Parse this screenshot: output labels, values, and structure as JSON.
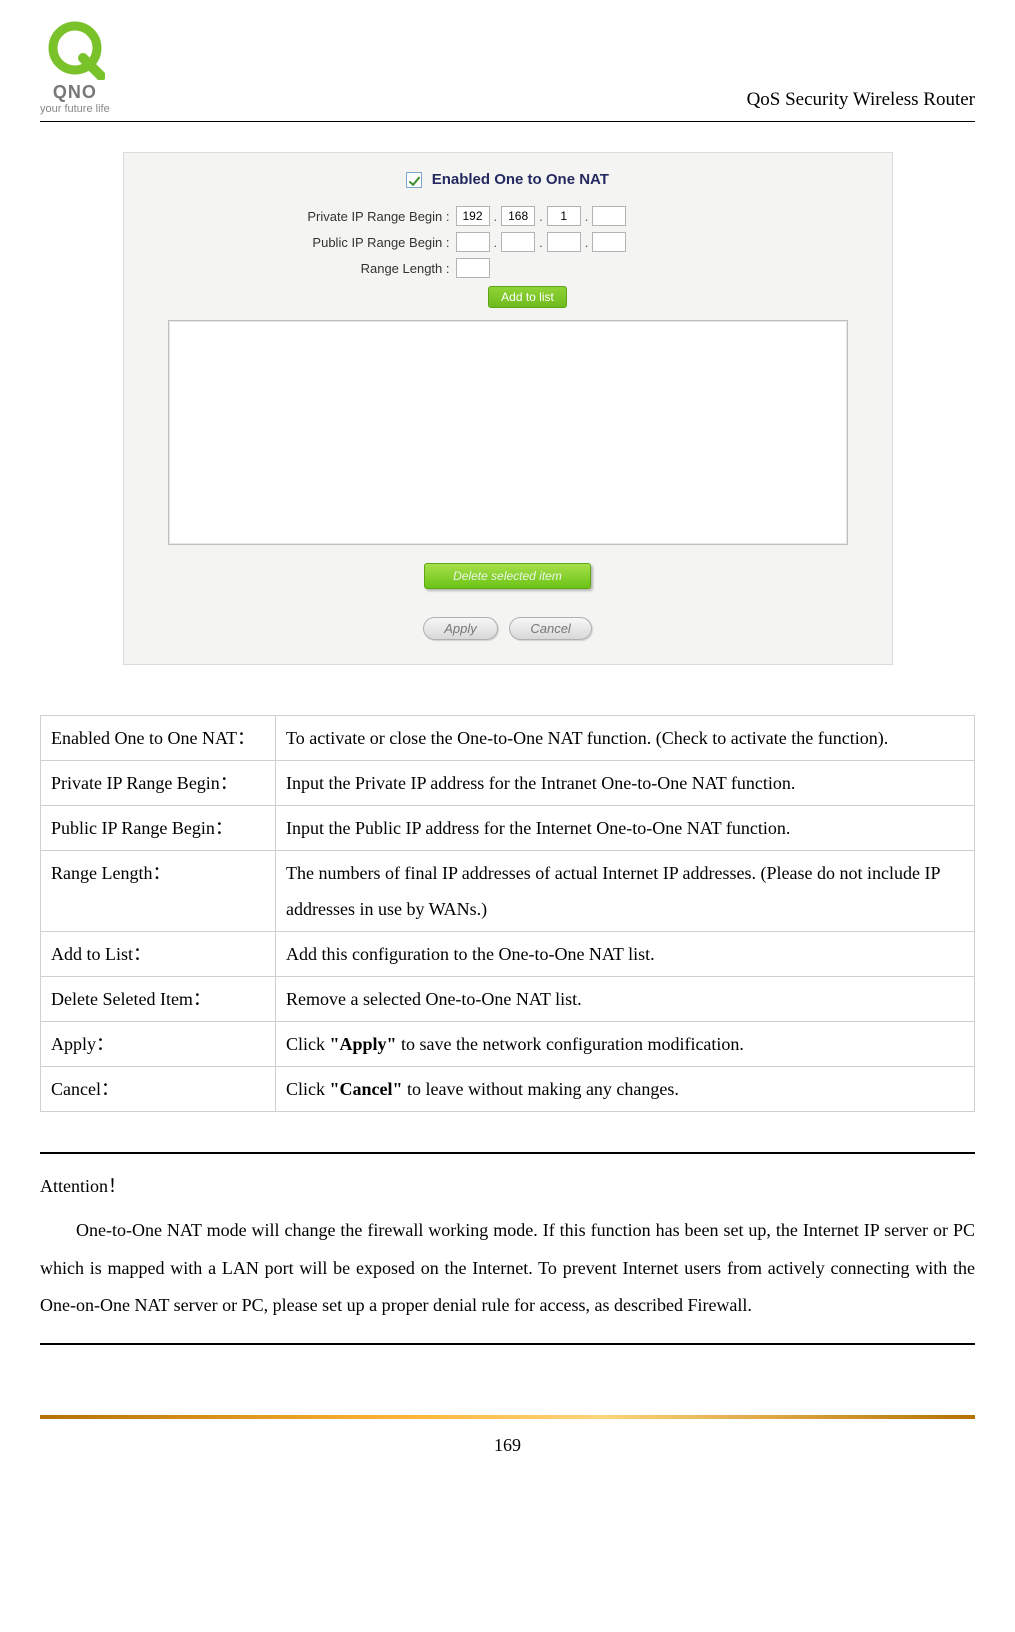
{
  "header": {
    "brand_line1": "QNO",
    "brand_line2": "your future life",
    "title": "QoS Security Wireless Router"
  },
  "panel": {
    "enable_label": "Enabled One to One NAT",
    "private_label": "Private IP Range Begin :",
    "public_label": "Public IP Range Begin :",
    "range_label": "Range Length :",
    "private_ip": [
      "192",
      "168",
      "1",
      ""
    ],
    "public_ip": [
      "",
      "",
      "",
      ""
    ],
    "range_value": "",
    "add_btn": "Add to list",
    "delete_btn": "Delete selected item",
    "apply_btn": "Apply",
    "cancel_btn": "Cancel"
  },
  "table": [
    {
      "label": "Enabled One to One NAT：",
      "desc_pre": "To activate or close the One-to-One NAT function. (Check to activate the function).",
      "bold": "",
      "desc_post": ""
    },
    {
      "label": "Private IP Range Begin：",
      "desc_pre": "Input the Private IP address for the Intranet One-to-One NAT function.",
      "bold": "",
      "desc_post": ""
    },
    {
      "label": "Public IP Range Begin：",
      "desc_pre": "Input the Public IP address for the Internet One-to-One NAT function.",
      "bold": "",
      "desc_post": ""
    },
    {
      "label": "Range Length：",
      "desc_pre": "The numbers of final IP addresses of actual Internet IP addresses. (Please do not include IP addresses in use by WANs.)",
      "bold": "",
      "desc_post": ""
    },
    {
      "label": "Add to List：",
      "desc_pre": "Add this configuration to the One-to-One NAT list.",
      "bold": "",
      "desc_post": ""
    },
    {
      "label": "Delete Seleted Item：",
      "desc_pre": "Remove a selected One-to-One NAT list.",
      "bold": "",
      "desc_post": ""
    },
    {
      "label": "Apply：",
      "desc_pre": "Click ",
      "bold": "\"Apply\"",
      "desc_post": " to save the network configuration modification."
    },
    {
      "label": "Cancel：",
      "desc_pre": "Click ",
      "bold": "\"Cancel\"",
      "desc_post": " to leave without making any changes."
    }
  ],
  "attention": {
    "title": "Attention！",
    "body": "One-to-One NAT mode will change the firewall working mode. If this function has been set up, the Internet IP server or PC which is mapped with a LAN port will be exposed on the Internet. To prevent Internet users from actively connecting with the One-on-One NAT server or PC, please set up a proper denial rule for access, as described Firewall."
  },
  "footer": {
    "page": "169"
  }
}
